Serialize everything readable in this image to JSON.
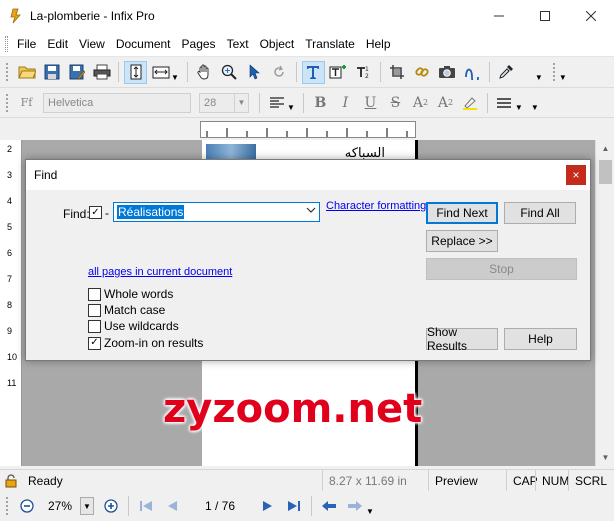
{
  "window": {
    "title": "La-plomberie - Infix Pro"
  },
  "menu": [
    "File",
    "Edit",
    "View",
    "Document",
    "Pages",
    "Text",
    "Object",
    "Translate",
    "Help"
  ],
  "format_bar": {
    "font_name": "Helvetica",
    "font_size": "28"
  },
  "page_preview": {
    "arabic_text": "السباكه"
  },
  "vruler_numbers": [
    "2",
    "3",
    "4",
    "5",
    "6",
    "7",
    "8",
    "9",
    "10",
    "11"
  ],
  "find_dialog": {
    "title": "Find",
    "close_glyph": "×",
    "find_label": "Find:",
    "find_dash": "-",
    "find_value": "Réalisations",
    "char_format_link": "Character formatting",
    "scope_link": "all pages in current document",
    "options": [
      {
        "label": "Whole words",
        "checked": false
      },
      {
        "label": "Match case",
        "checked": false
      },
      {
        "label": "Use wildcards",
        "checked": false
      },
      {
        "label": "Zoom-in on results",
        "checked": true
      }
    ],
    "buttons": {
      "find_next": "Find Next",
      "find_all": "Find All",
      "replace": "Replace >>",
      "stop": "Stop",
      "show_results": "Show Results",
      "help": "Help"
    }
  },
  "watermark": "zyzoom.net",
  "status": {
    "state": "Ready",
    "page_size": "8.27 x 11.69 in",
    "mode": "Preview",
    "cap": "CAP",
    "num": "NUM",
    "scrl": "SCRL"
  },
  "nav": {
    "zoom": "27%",
    "page": "1 / 76"
  },
  "colors": {
    "accent": "#0078d7",
    "close_red": "#c42b1c",
    "watermark_red": "#e0001c"
  }
}
